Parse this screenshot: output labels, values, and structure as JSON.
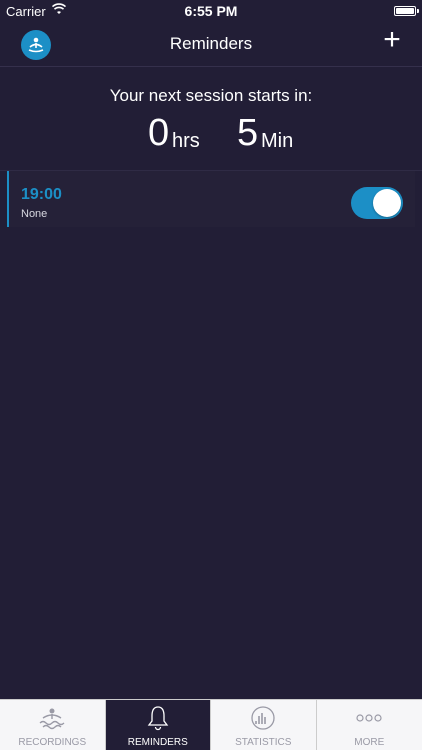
{
  "status": {
    "carrier": "Carrier",
    "time": "6:55 PM"
  },
  "header": {
    "title": "Reminders",
    "add_label": "+"
  },
  "countdown": {
    "title": "Your next session starts in:",
    "hours": "0",
    "hours_unit": "hrs",
    "minutes": "5",
    "minutes_unit": "Min"
  },
  "reminders": [
    {
      "time": "19:00",
      "label": "None",
      "enabled": true
    }
  ],
  "tabs": [
    {
      "label": "RECORDINGS",
      "icon": "recordings-icon",
      "active": false
    },
    {
      "label": "REMINDERS",
      "icon": "bell-icon",
      "active": true
    },
    {
      "label": "STATISTICS",
      "icon": "statistics-icon",
      "active": false
    },
    {
      "label": "MORE",
      "icon": "more-icon",
      "active": false
    }
  ],
  "colors": {
    "background": "#221e36",
    "accent": "#1c8fc6"
  }
}
